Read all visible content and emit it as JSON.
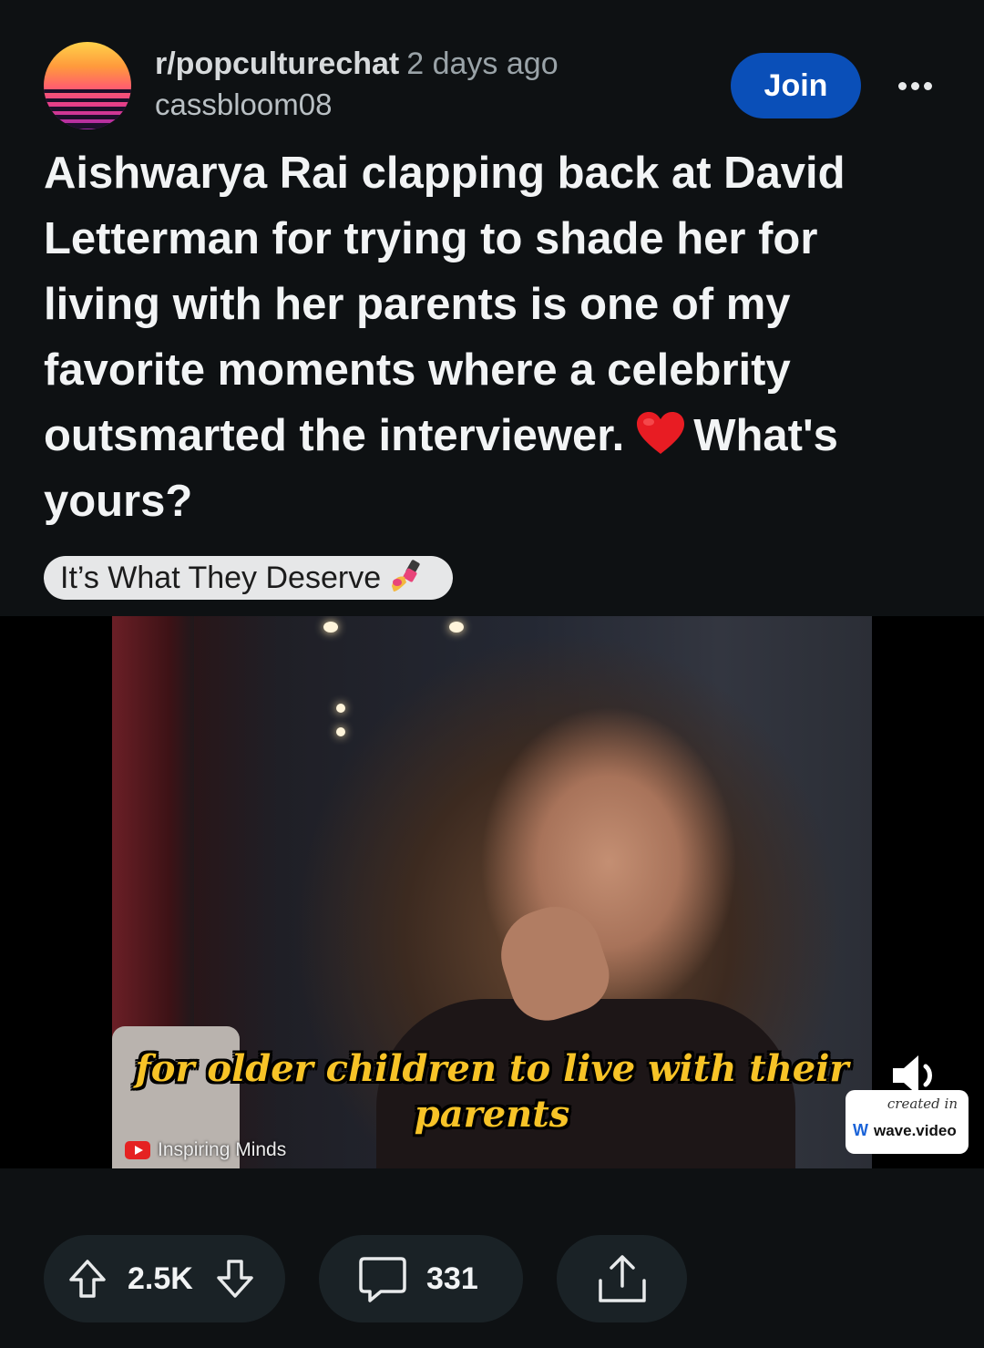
{
  "post": {
    "subreddit": "r/popculturechat",
    "time_ago": "2 days ago",
    "author": "cassbloom08",
    "join_label": "Join",
    "title_part1": "Aishwarya Rai clapping back at David Letterman for trying to shade her for living with her parents is one of my favorite moments where a celebrity outsmarted the interviewer.",
    "title_emoji": "heart-emoji",
    "title_part2": "What's yours?",
    "flair": {
      "text": "It’s What They Deserve",
      "emoji": "nail-polish-emoji"
    }
  },
  "media": {
    "caption_line1": "for older children to live with their",
    "caption_line2": "parents",
    "watermark": "Inspiring Minds",
    "badge_created": "created in",
    "badge_brand": "wave.video"
  },
  "actions": {
    "vote_count": "2.5K",
    "comment_count": "331"
  },
  "colors": {
    "background": "#0e1113",
    "join_button": "#0a4fb8",
    "action_pill": "#1a2226",
    "caption_text": "#f7c327",
    "flair_bg": "#e6e7e8"
  },
  "icons": [
    "subreddit-avatar",
    "more-options-icon",
    "heart-emoji",
    "nail-polish-emoji",
    "youtube-icon",
    "sound-icon",
    "upvote-icon",
    "downvote-icon",
    "comment-icon",
    "share-icon"
  ]
}
